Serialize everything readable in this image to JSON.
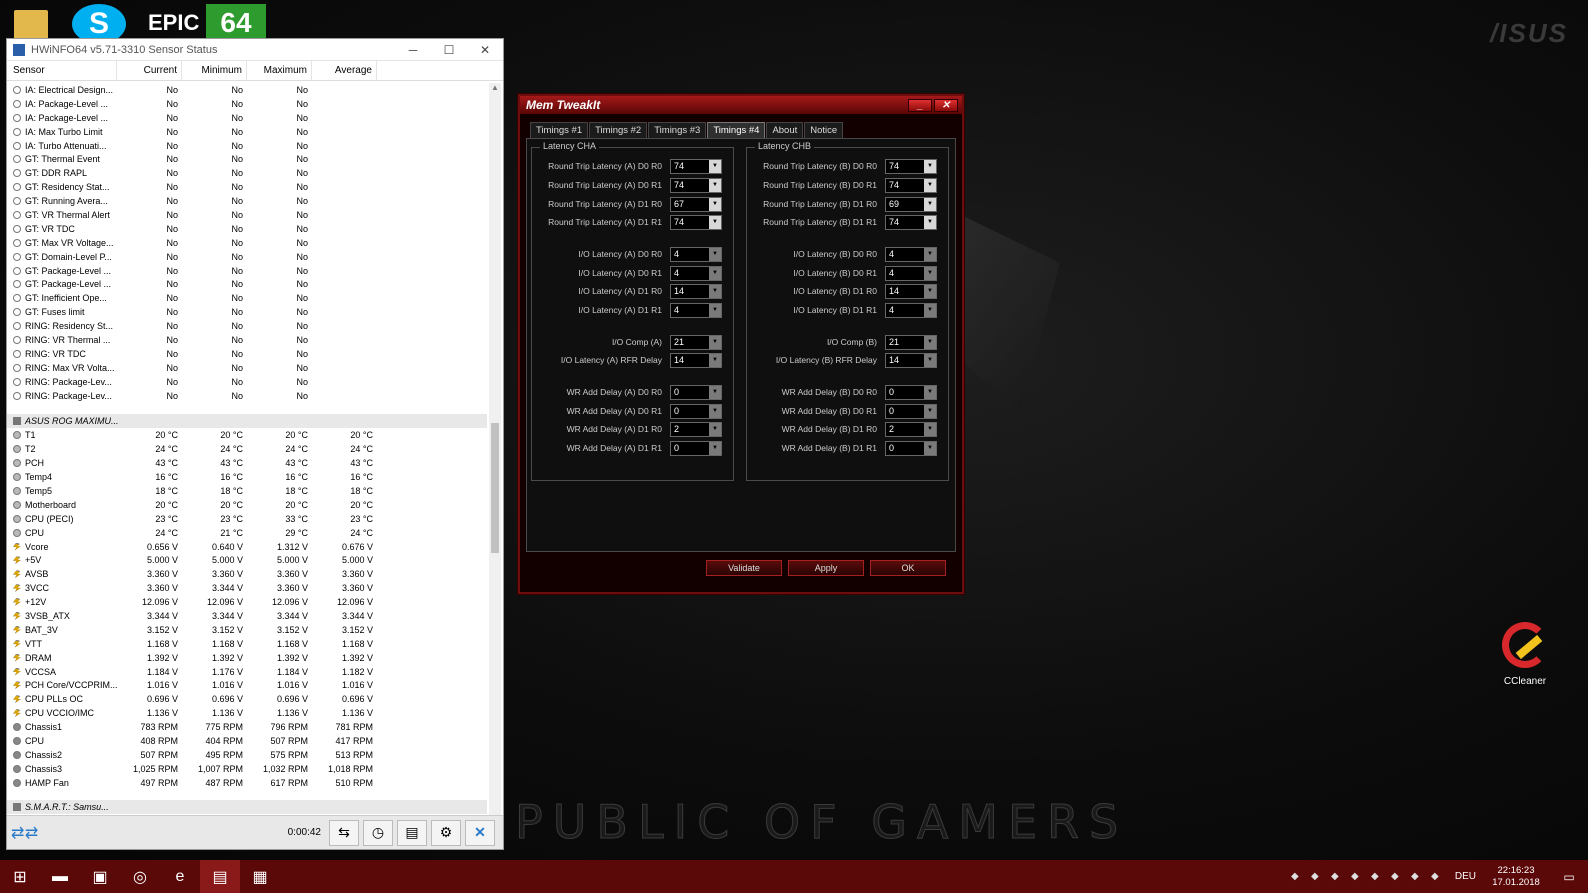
{
  "desktop": {
    "top_icons": [
      {
        "icon": "folder-icon",
        "color": "#e2b84c"
      },
      {
        "icon": "skype-icon",
        "color": "#00aff0"
      },
      {
        "icon": "epic-icon",
        "label": "EPIC"
      },
      {
        "icon": "aida64-icon",
        "label": "64",
        "color": "#2e9b2e"
      }
    ],
    "wallpaper_text": "PUBLIC OF GAMERS",
    "brand_logo": "/ISUS",
    "ccleaner": {
      "label": "CCleaner"
    }
  },
  "hwinfo": {
    "title": "HWiNFO64 v5.71-3310 Sensor Status",
    "columns": [
      "Sensor",
      "Current",
      "Minimum",
      "Maximum",
      "Average"
    ],
    "rows_top": [
      {
        "name": "IA: Electrical Design...",
        "cur": "No",
        "min": "No",
        "max": "No",
        "avg": ""
      },
      {
        "name": "IA: Package-Level ...",
        "cur": "No",
        "min": "No",
        "max": "No",
        "avg": ""
      },
      {
        "name": "IA: Package-Level ...",
        "cur": "No",
        "min": "No",
        "max": "No",
        "avg": ""
      },
      {
        "name": "IA: Max Turbo Limit",
        "cur": "No",
        "min": "No",
        "max": "No",
        "avg": ""
      },
      {
        "name": "IA: Turbo Attenuati...",
        "cur": "No",
        "min": "No",
        "max": "No",
        "avg": ""
      },
      {
        "name": "GT: Thermal Event",
        "cur": "No",
        "min": "No",
        "max": "No",
        "avg": ""
      },
      {
        "name": "GT: DDR RAPL",
        "cur": "No",
        "min": "No",
        "max": "No",
        "avg": ""
      },
      {
        "name": "GT: Residency Stat...",
        "cur": "No",
        "min": "No",
        "max": "No",
        "avg": ""
      },
      {
        "name": "GT: Running Avera...",
        "cur": "No",
        "min": "No",
        "max": "No",
        "avg": ""
      },
      {
        "name": "GT: VR Thermal Alert",
        "cur": "No",
        "min": "No",
        "max": "No",
        "avg": ""
      },
      {
        "name": "GT: VR TDC",
        "cur": "No",
        "min": "No",
        "max": "No",
        "avg": ""
      },
      {
        "name": "GT: Max VR Voltage...",
        "cur": "No",
        "min": "No",
        "max": "No",
        "avg": ""
      },
      {
        "name": "GT: Domain-Level P...",
        "cur": "No",
        "min": "No",
        "max": "No",
        "avg": ""
      },
      {
        "name": "GT: Package-Level ...",
        "cur": "No",
        "min": "No",
        "max": "No",
        "avg": ""
      },
      {
        "name": "GT: Package-Level ...",
        "cur": "No",
        "min": "No",
        "max": "No",
        "avg": ""
      },
      {
        "name": "GT: Inefficient Ope...",
        "cur": "No",
        "min": "No",
        "max": "No",
        "avg": ""
      },
      {
        "name": "GT: Fuses limit",
        "cur": "No",
        "min": "No",
        "max": "No",
        "avg": ""
      },
      {
        "name": "RING: Residency St...",
        "cur": "No",
        "min": "No",
        "max": "No",
        "avg": ""
      },
      {
        "name": "RING: VR Thermal ...",
        "cur": "No",
        "min": "No",
        "max": "No",
        "avg": ""
      },
      {
        "name": "RING: VR TDC",
        "cur": "No",
        "min": "No",
        "max": "No",
        "avg": ""
      },
      {
        "name": "RING: Max VR Volta...",
        "cur": "No",
        "min": "No",
        "max": "No",
        "avg": ""
      },
      {
        "name": "RING: Package-Lev...",
        "cur": "No",
        "min": "No",
        "max": "No",
        "avg": ""
      },
      {
        "name": "RING: Package-Lev...",
        "cur": "No",
        "min": "No",
        "max": "No",
        "avg": ""
      }
    ],
    "group_asus": "ASUS ROG MAXIMU...",
    "rows_asus": [
      {
        "type": "therm",
        "name": "T1",
        "cur": "20 °C",
        "min": "20 °C",
        "max": "20 °C",
        "avg": "20 °C"
      },
      {
        "type": "therm",
        "name": "T2",
        "cur": "24 °C",
        "min": "24 °C",
        "max": "24 °C",
        "avg": "24 °C"
      },
      {
        "type": "therm",
        "name": "PCH",
        "cur": "43 °C",
        "min": "43 °C",
        "max": "43 °C",
        "avg": "43 °C"
      },
      {
        "type": "therm",
        "name": "Temp4",
        "cur": "16 °C",
        "min": "16 °C",
        "max": "16 °C",
        "avg": "16 °C"
      },
      {
        "type": "therm",
        "name": "Temp5",
        "cur": "18 °C",
        "min": "18 °C",
        "max": "18 °C",
        "avg": "18 °C"
      },
      {
        "type": "therm",
        "name": "Motherboard",
        "cur": "20 °C",
        "min": "20 °C",
        "max": "20 °C",
        "avg": "20 °C"
      },
      {
        "type": "therm",
        "name": "CPU (PECI)",
        "cur": "23 °C",
        "min": "23 °C",
        "max": "33 °C",
        "avg": "23 °C"
      },
      {
        "type": "therm",
        "name": "CPU",
        "cur": "24 °C",
        "min": "21 °C",
        "max": "29 °C",
        "avg": "24 °C"
      },
      {
        "type": "volt",
        "name": "Vcore",
        "cur": "0.656 V",
        "min": "0.640 V",
        "max": "1.312 V",
        "avg": "0.676 V"
      },
      {
        "type": "volt",
        "name": "+5V",
        "cur": "5.000 V",
        "min": "5.000 V",
        "max": "5.000 V",
        "avg": "5.000 V"
      },
      {
        "type": "volt",
        "name": "AVSB",
        "cur": "3.360 V",
        "min": "3.360 V",
        "max": "3.360 V",
        "avg": "3.360 V"
      },
      {
        "type": "volt",
        "name": "3VCC",
        "cur": "3.360 V",
        "min": "3.344 V",
        "max": "3.360 V",
        "avg": "3.360 V"
      },
      {
        "type": "volt",
        "name": "+12V",
        "cur": "12.096 V",
        "min": "12.096 V",
        "max": "12.096 V",
        "avg": "12.096 V"
      },
      {
        "type": "volt",
        "name": "3VSB_ATX",
        "cur": "3.344 V",
        "min": "3.344 V",
        "max": "3.344 V",
        "avg": "3.344 V"
      },
      {
        "type": "volt",
        "name": "BAT_3V",
        "cur": "3.152 V",
        "min": "3.152 V",
        "max": "3.152 V",
        "avg": "3.152 V"
      },
      {
        "type": "volt",
        "name": "VTT",
        "cur": "1.168 V",
        "min": "1.168 V",
        "max": "1.168 V",
        "avg": "1.168 V"
      },
      {
        "type": "volt",
        "name": "DRAM",
        "cur": "1.392 V",
        "min": "1.392 V",
        "max": "1.392 V",
        "avg": "1.392 V"
      },
      {
        "type": "volt",
        "name": "VCCSA",
        "cur": "1.184 V",
        "min": "1.176 V",
        "max": "1.184 V",
        "avg": "1.182 V"
      },
      {
        "type": "volt",
        "name": "PCH Core/VCCPRIM...",
        "cur": "1.016 V",
        "min": "1.016 V",
        "max": "1.016 V",
        "avg": "1.016 V"
      },
      {
        "type": "volt",
        "name": "CPU PLLs OC",
        "cur": "0.696 V",
        "min": "0.696 V",
        "max": "0.696 V",
        "avg": "0.696 V"
      },
      {
        "type": "volt",
        "name": "CPU VCCIO/IMC",
        "cur": "1.136 V",
        "min": "1.136 V",
        "max": "1.136 V",
        "avg": "1.136 V"
      },
      {
        "type": "fan",
        "name": "Chassis1",
        "cur": "783 RPM",
        "min": "775 RPM",
        "max": "796 RPM",
        "avg": "781 RPM"
      },
      {
        "type": "fan",
        "name": "CPU",
        "cur": "408 RPM",
        "min": "404 RPM",
        "max": "507 RPM",
        "avg": "417 RPM"
      },
      {
        "type": "fan",
        "name": "Chassis2",
        "cur": "507 RPM",
        "min": "495 RPM",
        "max": "575 RPM",
        "avg": "513 RPM"
      },
      {
        "type": "fan",
        "name": "Chassis3",
        "cur": "1,025 RPM",
        "min": "1,007 RPM",
        "max": "1,032 RPM",
        "avg": "1,018 RPM"
      },
      {
        "type": "fan",
        "name": "HAMP Fan",
        "cur": "497 RPM",
        "min": "487 RPM",
        "max": "617 RPM",
        "avg": "510 RPM"
      }
    ],
    "group_smart": "S.M.A.R.T.: Samsu...",
    "timer": "0:00:42"
  },
  "memtweak": {
    "title": "Mem TweakIt",
    "tabs": [
      "Timings #1",
      "Timings #2",
      "Timings #3",
      "Timings #4",
      "About",
      "Notice"
    ],
    "active_tab": 3,
    "cha": {
      "legend": "Latency CHA",
      "fields": [
        {
          "label": "Round Trip Latency (A) D0 R0",
          "value": "74",
          "enabled": true
        },
        {
          "label": "Round Trip Latency (A) D0 R1",
          "value": "74",
          "enabled": true
        },
        {
          "label": "Round Trip Latency (A) D1 R0",
          "value": "67",
          "enabled": true
        },
        {
          "label": "Round Trip Latency (A) D1 R1",
          "value": "74",
          "enabled": true
        },
        {
          "label": "I/O Latency (A) D0 R0",
          "value": "4",
          "enabled": false
        },
        {
          "label": "I/O Latency (A) D0 R1",
          "value": "4",
          "enabled": false
        },
        {
          "label": "I/O Latency (A) D1 R0",
          "value": "14",
          "enabled": false
        },
        {
          "label": "I/O Latency (A) D1 R1",
          "value": "4",
          "enabled": false
        },
        {
          "label": "I/O Comp (A)",
          "value": "21",
          "enabled": false
        },
        {
          "label": "I/O Latency (A) RFR Delay",
          "value": "14",
          "enabled": false
        },
        {
          "label": "WR Add Delay (A) D0 R0",
          "value": "0",
          "enabled": false
        },
        {
          "label": "WR Add Delay (A) D0 R1",
          "value": "0",
          "enabled": false
        },
        {
          "label": "WR Add Delay (A) D1 R0",
          "value": "2",
          "enabled": false
        },
        {
          "label": "WR Add Delay (A) D1 R1",
          "value": "0",
          "enabled": false
        }
      ]
    },
    "chb": {
      "legend": "Latency CHB",
      "fields": [
        {
          "label": "Round Trip Latency (B) D0 R0",
          "value": "74",
          "enabled": true
        },
        {
          "label": "Round Trip Latency (B) D0 R1",
          "value": "74",
          "enabled": true
        },
        {
          "label": "Round Trip Latency (B) D1 R0",
          "value": "69",
          "enabled": true
        },
        {
          "label": "Round Trip Latency (B) D1 R1",
          "value": "74",
          "enabled": true
        },
        {
          "label": "I/O Latency (B) D0 R0",
          "value": "4",
          "enabled": false
        },
        {
          "label": "I/O Latency (B) D0 R1",
          "value": "4",
          "enabled": false
        },
        {
          "label": "I/O Latency (B) D1 R0",
          "value": "14",
          "enabled": false
        },
        {
          "label": "I/O Latency (B) D1 R1",
          "value": "4",
          "enabled": false
        },
        {
          "label": "I/O Comp (B)",
          "value": "21",
          "enabled": false
        },
        {
          "label": "I/O Latency (B) RFR Delay",
          "value": "14",
          "enabled": false
        },
        {
          "label": "WR Add Delay (B) D0 R0",
          "value": "0",
          "enabled": false
        },
        {
          "label": "WR Add Delay (B) D0 R1",
          "value": "0",
          "enabled": false
        },
        {
          "label": "WR Add Delay (B) D1 R0",
          "value": "2",
          "enabled": false
        },
        {
          "label": "WR Add Delay (B) D1 R1",
          "value": "0",
          "enabled": false
        }
      ]
    },
    "buttons": {
      "validate": "Validate",
      "apply": "Apply",
      "ok": "OK"
    }
  },
  "taskbar": {
    "items": [
      {
        "icon": "windows-start-icon",
        "glyph": "⊞"
      },
      {
        "icon": "file-explorer-icon",
        "glyph": "▬"
      },
      {
        "icon": "store-icon",
        "glyph": "▣"
      },
      {
        "icon": "settings-app-icon",
        "glyph": "◎"
      },
      {
        "icon": "edge-icon",
        "glyph": "e"
      },
      {
        "icon": "memtweakit-icon",
        "glyph": "▤"
      },
      {
        "icon": "hwinfo-icon",
        "glyph": "▦"
      }
    ],
    "tray_icons": [
      "hwinfo-tray-icon",
      "asus-tray-icon",
      "network-tray-icon",
      "nvidia-tray-icon",
      "usb-tray-icon",
      "app-tray-icon",
      "wifi-tray-icon",
      "volume-tray-icon"
    ],
    "language": "DEU",
    "time": "22:16:23",
    "date": "17.01.2018"
  }
}
